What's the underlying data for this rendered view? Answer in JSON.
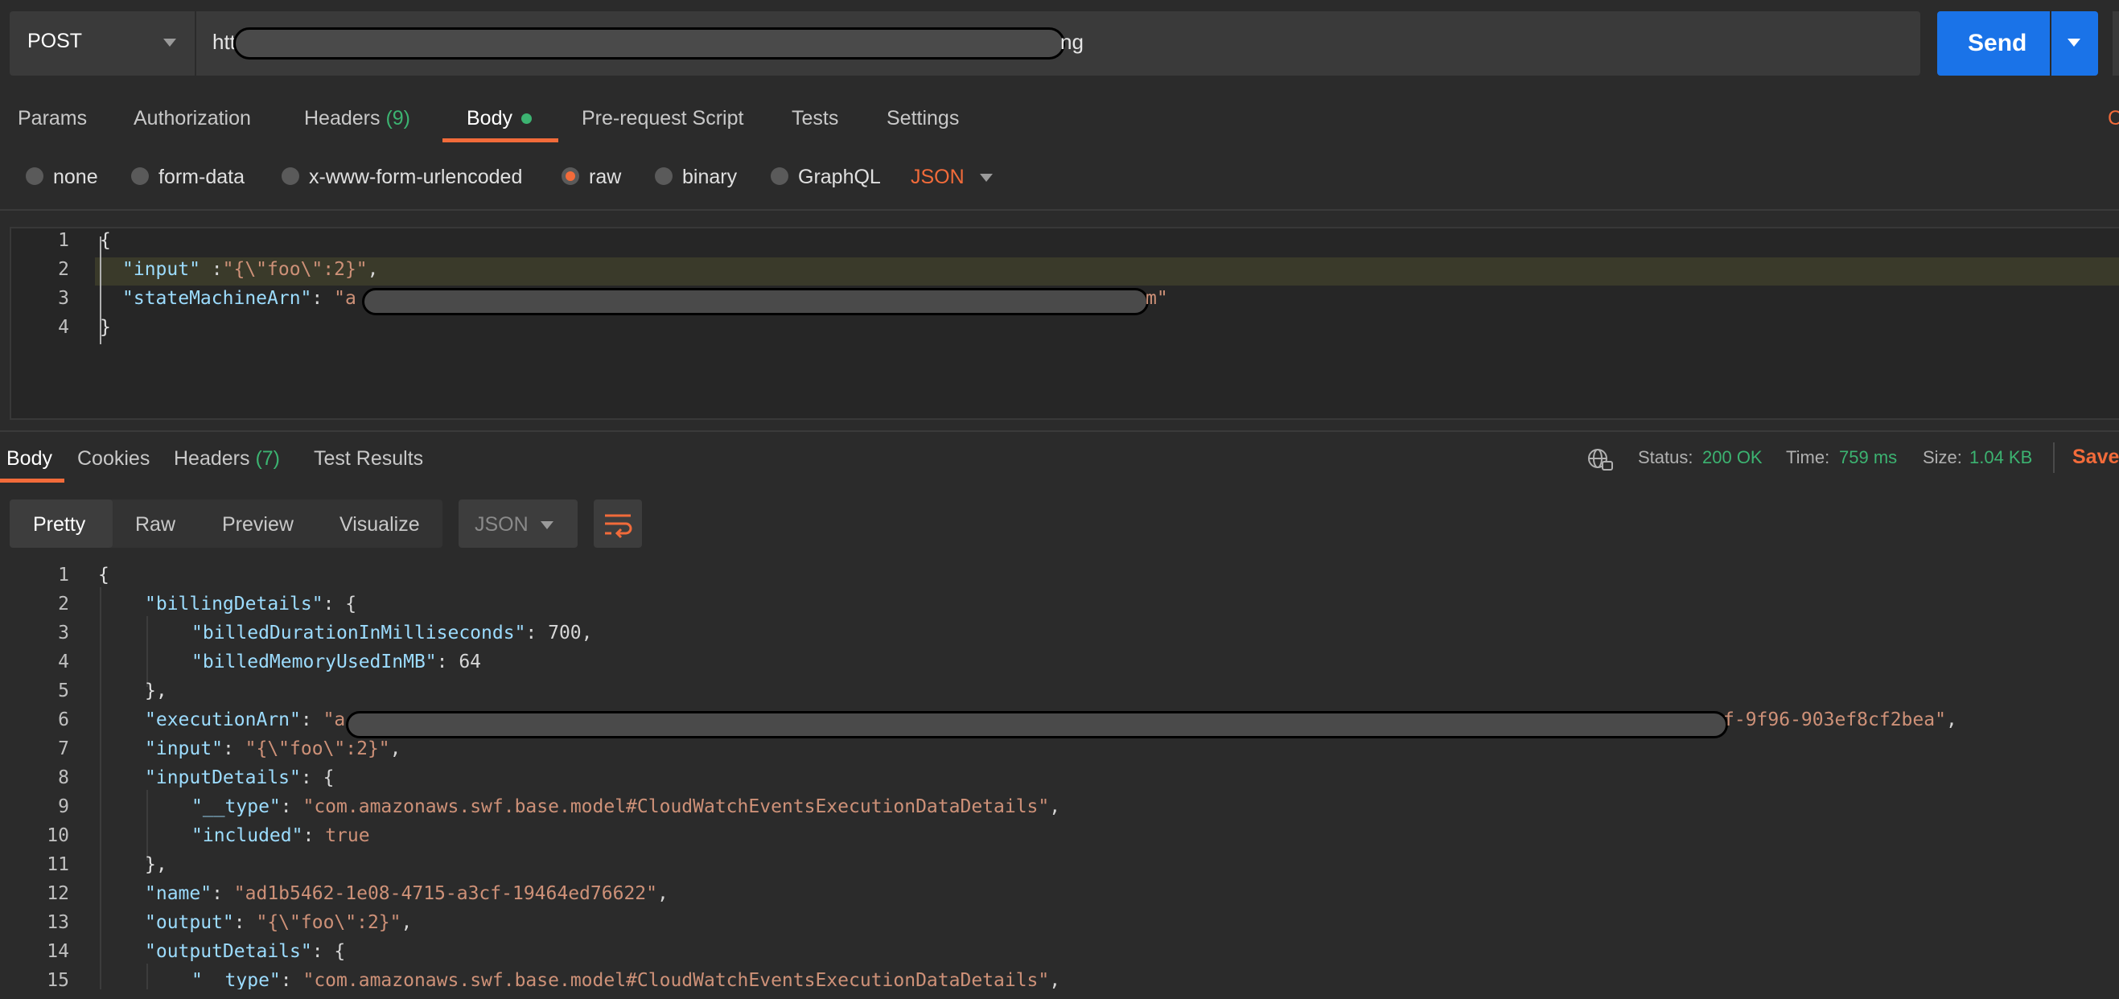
{
  "request": {
    "method": "POST",
    "url_visible_start": "htt",
    "url_visible_end": "ng",
    "send_label": "Send"
  },
  "request_tabs": [
    {
      "label": "Params"
    },
    {
      "label": "Authorization"
    },
    {
      "label": "Headers",
      "count": "(9)"
    },
    {
      "label": "Body",
      "active": true
    },
    {
      "label": "Pre-request Script"
    },
    {
      "label": "Tests"
    },
    {
      "label": "Settings"
    }
  ],
  "cookies_edge": "C",
  "body_types": {
    "none": "none",
    "form_data": "form-data",
    "urlencoded": "x-www-form-urlencoded",
    "raw": "raw",
    "binary": "binary",
    "graphql": "GraphQL",
    "format": "JSON",
    "selected": "raw"
  },
  "request_body": {
    "line_numbers": [
      "1",
      "2",
      "3",
      "4"
    ],
    "open": "{",
    "input_key": "\"input\"",
    "input_sep": " :",
    "input_val": "\"{\\\"foo\\\":2}\"",
    "comma": ",",
    "arn_key": "\"stateMachineArn\"",
    "colon": ": ",
    "arn_val_start": "\"a",
    "arn_val_end": "m\"",
    "close": "}"
  },
  "response_tabs": {
    "body": "Body",
    "cookies": "Cookies",
    "headers": "Headers",
    "headers_count": "(7)",
    "tests": "Test Results"
  },
  "response_meta": {
    "status_label": "Status:",
    "status_value": "200 OK",
    "time_label": "Time:",
    "time_value": "759 ms",
    "size_label": "Size:",
    "size_value": "1.04 KB",
    "save": "Save"
  },
  "view_modes": {
    "pretty": "Pretty",
    "raw": "Raw",
    "preview": "Preview",
    "visualize": "Visualize",
    "format": "JSON"
  },
  "response_body": {
    "line_numbers": [
      "1",
      "2",
      "3",
      "4",
      "5",
      "6",
      "7",
      "8",
      "9",
      "10",
      "11",
      "12",
      "13",
      "14",
      "15"
    ],
    "l1": "{",
    "l2_key": "\"billingDetails\"",
    "l2_rest": ": {",
    "l3_key": "\"billedDurationInMilliseconds\"",
    "l3_rest": ": 700,",
    "l4_key": "\"billedMemoryUsedInMB\"",
    "l4_rest": ": 64",
    "l5": "},",
    "l6_key": "\"executionArn\"",
    "l6_colon": ": ",
    "l6_val_start": "\"a",
    "l6_val_end": "f-9f96-903ef8cf2bea\"",
    "l6_comma": ",",
    "l7_key": "\"input\"",
    "l7_colon": ": ",
    "l7_val": "\"{\\\"foo\\\":2}\"",
    "l7_comma": ",",
    "l8_key": "\"inputDetails\"",
    "l8_rest": ": {",
    "l9_key": "\"__type\"",
    "l9_colon": ": ",
    "l9_val": "\"com.amazonaws.swf.base.model#CloudWatchEventsExecutionDataDetails\"",
    "l9_comma": ",",
    "l10_key": "\"included\"",
    "l10_colon": ": ",
    "l10_val": "true",
    "l11": "},",
    "l12_key": "\"name\"",
    "l12_colon": ": ",
    "l12_val": "\"ad1b5462-1e08-4715-a3cf-19464ed76622\"",
    "l12_comma": ",",
    "l13_key": "\"output\"",
    "l13_colon": ": ",
    "l13_val": "\"{\\\"foo\\\":2}\"",
    "l13_comma": ",",
    "l14_key": "\"outputDetails\"",
    "l14_rest": ": {",
    "l15_key": "\"__type\"",
    "l15_colon": ": ",
    "l15_val": "\"com.amazonaws.swf.base.model#CloudWatchEventsExecutionDataDetails\"",
    "l15_comma": ","
  },
  "colors": {
    "accent": "#f26b3a",
    "send": "#1a73e8",
    "success": "#3cb371",
    "json_key": "#9cdcfe",
    "json_string": "#ce9178"
  },
  "icons": {
    "method_caret": "chevron-down-icon",
    "send_caret": "chevron-down-icon",
    "network": "globe-lock-icon",
    "wrap": "wrap-lines-icon"
  }
}
